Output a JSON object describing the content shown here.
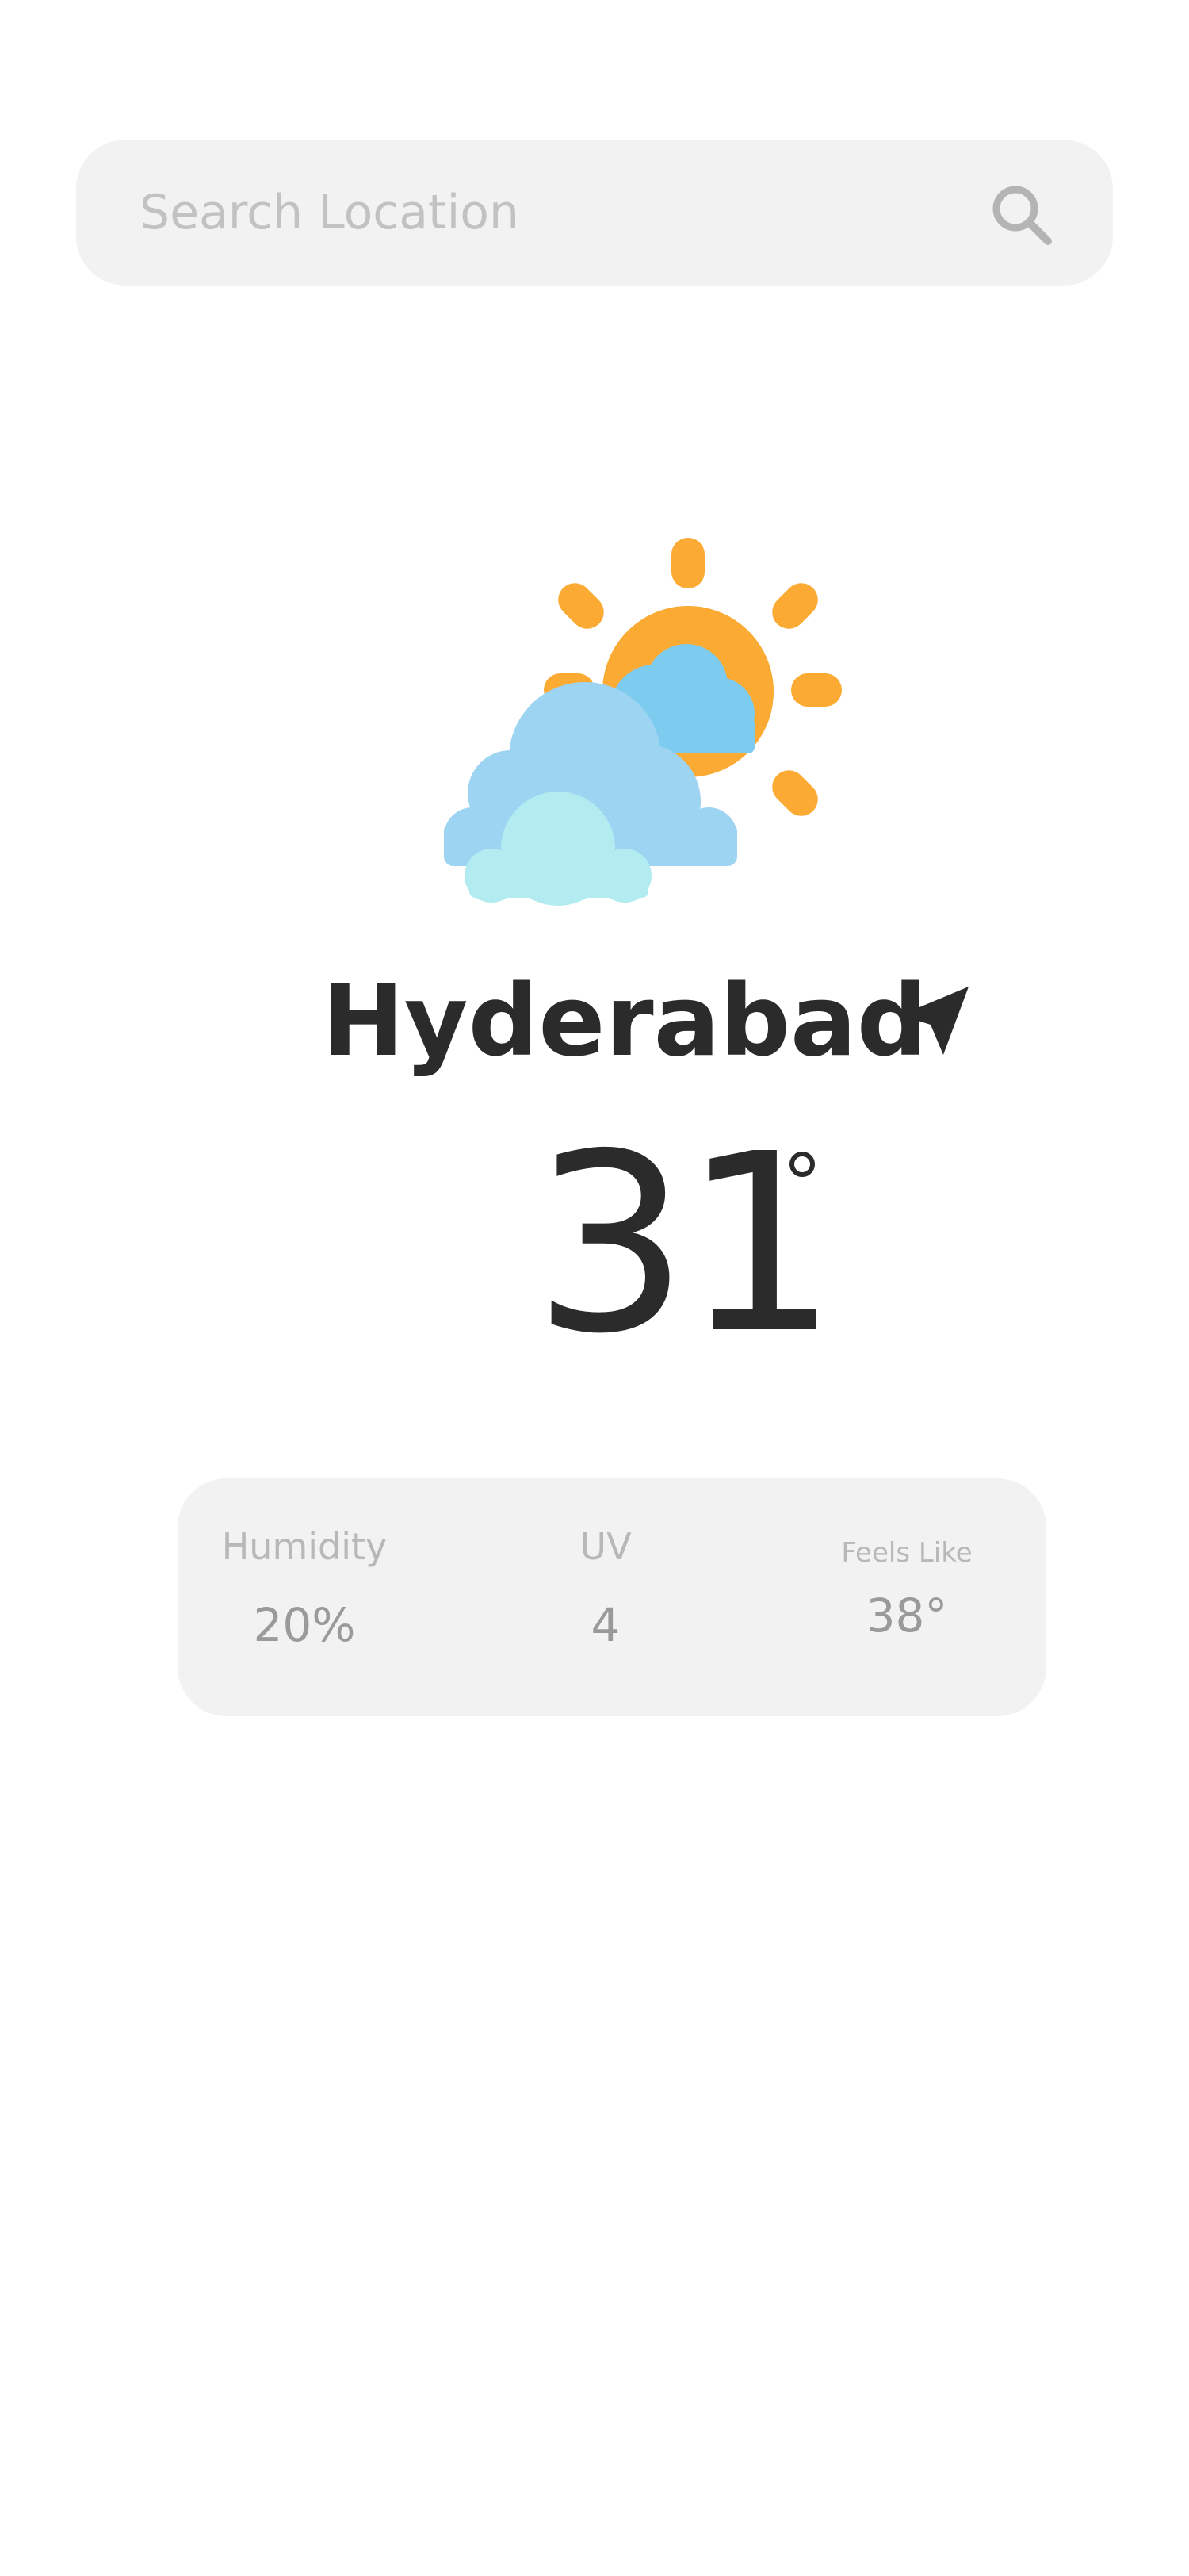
{
  "search": {
    "placeholder": "Search Location",
    "value": ""
  },
  "weather": {
    "condition_icon": "partly-cloudy-icon",
    "city": "Hyderabad",
    "temperature": "31",
    "location_icon": "navigation-arrow-icon",
    "degree_icon": "degree-symbol"
  },
  "stats": {
    "humidity": {
      "label": "Humidity",
      "value": "20%"
    },
    "uv": {
      "label": "UV",
      "value": "4"
    },
    "feels_like": {
      "label": "Feels Like",
      "value": "38°"
    }
  },
  "colors": {
    "sun": "#fbab34",
    "cloud_back": "#7ecbf0",
    "cloud_mid": "#9dd4f1",
    "cloud_front": "#b2ecf1",
    "text_primary": "#2b2b2b",
    "card_bg": "#f2f2f2"
  }
}
